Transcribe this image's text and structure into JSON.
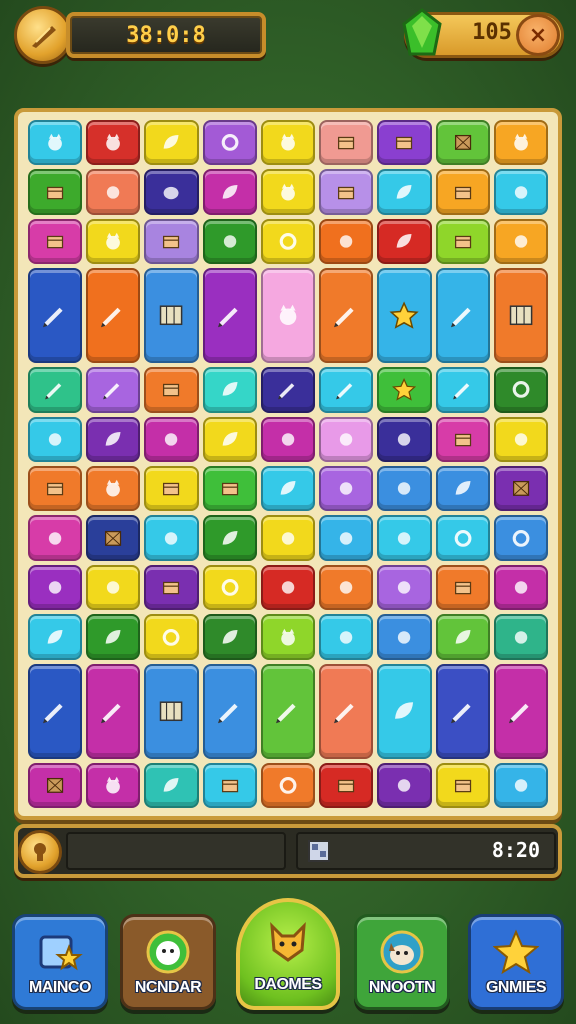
{
  "top": {
    "timer": "38:0:8",
    "score": "105",
    "close_label": "×"
  },
  "board": {
    "tiles": [
      {
        "c": 0,
        "r": 0,
        "w": 1,
        "h": 1,
        "color": "#35c9e8",
        "icon": "cat-face-icon"
      },
      {
        "c": 1,
        "r": 0,
        "w": 1,
        "h": 1,
        "color": "#d6302a",
        "icon": "frog-icon"
      },
      {
        "c": 2,
        "r": 0,
        "w": 1,
        "h": 1,
        "color": "#f2d91c",
        "icon": "leaf-icon"
      },
      {
        "c": 3,
        "r": 0,
        "w": 1,
        "h": 1,
        "color": "#a35ad6",
        "icon": "swirl-icon"
      },
      {
        "c": 4,
        "r": 0,
        "w": 1,
        "h": 1,
        "color": "#f2d91c",
        "icon": "bird-icon"
      },
      {
        "c": 5,
        "r": 0,
        "w": 1,
        "h": 1,
        "color": "#f09a92",
        "icon": "box-icon"
      },
      {
        "c": 6,
        "r": 0,
        "w": 1,
        "h": 1,
        "color": "#8a3fd0",
        "icon": "book-icon"
      },
      {
        "c": 7,
        "r": 0,
        "w": 1,
        "h": 1,
        "color": "#62c43a",
        "icon": "crate-icon"
      },
      {
        "c": 8,
        "r": 0,
        "w": 1,
        "h": 1,
        "color": "#f7a623",
        "icon": "cat-icon"
      },
      {
        "c": 0,
        "r": 1,
        "w": 1,
        "h": 1,
        "color": "#3daa2c",
        "icon": "block-icon"
      },
      {
        "c": 1,
        "r": 1,
        "w": 1,
        "h": 1,
        "color": "#f07a55",
        "icon": "roll-icon"
      },
      {
        "c": 2,
        "r": 1,
        "w": 1,
        "h": 1,
        "color": "#3a2f9a",
        "icon": "blob-icon"
      },
      {
        "c": 3,
        "r": 1,
        "w": 1,
        "h": 1,
        "color": "#c42fa8",
        "icon": "bush-icon"
      },
      {
        "c": 4,
        "r": 1,
        "w": 1,
        "h": 1,
        "color": "#f2d91c",
        "icon": "cat-icon"
      },
      {
        "c": 5,
        "r": 1,
        "w": 1,
        "h": 1,
        "color": "#b790e8",
        "icon": "chest-icon"
      },
      {
        "c": 6,
        "r": 1,
        "w": 1,
        "h": 1,
        "color": "#35c9e8",
        "icon": "hat-icon"
      },
      {
        "c": 7,
        "r": 1,
        "w": 1,
        "h": 1,
        "color": "#f7a623",
        "icon": "box-icon"
      },
      {
        "c": 8,
        "r": 1,
        "w": 1,
        "h": 1,
        "color": "#35c9e8",
        "icon": "apple-icon"
      },
      {
        "c": 0,
        "r": 2,
        "w": 1,
        "h": 1,
        "color": "#d73ca8",
        "icon": "box-icon"
      },
      {
        "c": 1,
        "r": 2,
        "w": 1,
        "h": 1,
        "color": "#f2d91c",
        "icon": "bunny-icon"
      },
      {
        "c": 2,
        "r": 2,
        "w": 1,
        "h": 1,
        "color": "#a884e0",
        "icon": "cube-icon"
      },
      {
        "c": 3,
        "r": 2,
        "w": 1,
        "h": 1,
        "color": "#2f9a2a",
        "icon": "paw-icon"
      },
      {
        "c": 4,
        "r": 2,
        "w": 1,
        "h": 1,
        "color": "#f2d91c",
        "icon": "spiral-icon"
      },
      {
        "c": 5,
        "r": 2,
        "w": 1,
        "h": 1,
        "color": "#f0701e",
        "icon": "roll-icon"
      },
      {
        "c": 6,
        "r": 2,
        "w": 1,
        "h": 1,
        "color": "#d62a24",
        "icon": "hat-icon"
      },
      {
        "c": 7,
        "r": 2,
        "w": 1,
        "h": 1,
        "color": "#8fd62a",
        "icon": "cube-icon"
      },
      {
        "c": 8,
        "r": 2,
        "w": 1,
        "h": 1,
        "color": "#f7a623",
        "icon": "cross-icon"
      },
      {
        "c": 0,
        "r": 3,
        "w": 1,
        "h": 2,
        "color": "#2a58c4",
        "icon": "pencil-icon"
      },
      {
        "c": 1,
        "r": 3,
        "w": 1,
        "h": 2,
        "color": "#f0701e",
        "icon": "pencil-icon"
      },
      {
        "c": 2,
        "r": 3,
        "w": 1,
        "h": 2,
        "color": "#3b8fe0",
        "icon": "map-icon"
      },
      {
        "c": 3,
        "r": 3,
        "w": 1,
        "h": 2,
        "color": "#9a2fc0",
        "icon": "pencil-icon"
      },
      {
        "c": 4,
        "r": 3,
        "w": 1,
        "h": 2,
        "color": "#f5a8e0",
        "icon": "robot-icon"
      },
      {
        "c": 5,
        "r": 3,
        "w": 1,
        "h": 2,
        "color": "#f07a2a",
        "icon": "pencil-icon"
      },
      {
        "c": 6,
        "r": 3,
        "w": 1,
        "h": 2,
        "color": "#35b4e8",
        "icon": "star-icon"
      },
      {
        "c": 7,
        "r": 3,
        "w": 1,
        "h": 2,
        "color": "#35b4e8",
        "icon": "pencil-icon"
      },
      {
        "c": 8,
        "r": 3,
        "w": 1,
        "h": 2,
        "color": "#f07a2a",
        "icon": "map-icon"
      },
      {
        "c": 0,
        "r": 5,
        "w": 1,
        "h": 1,
        "color": "#2fc28a",
        "icon": "pencil-icon"
      },
      {
        "c": 1,
        "r": 5,
        "w": 1,
        "h": 1,
        "color": "#a865e0",
        "icon": "pencil-icon"
      },
      {
        "c": 2,
        "r": 5,
        "w": 1,
        "h": 1,
        "color": "#f07a2a",
        "icon": "calendar-icon"
      },
      {
        "c": 3,
        "r": 5,
        "w": 1,
        "h": 1,
        "color": "#35d6c8",
        "icon": "leaf-icon"
      },
      {
        "c": 4,
        "r": 5,
        "w": 1,
        "h": 1,
        "color": "#3a2f9a",
        "icon": "pencil-icon"
      },
      {
        "c": 5,
        "r": 5,
        "w": 1,
        "h": 1,
        "color": "#35c9e8",
        "icon": "pencil-icon"
      },
      {
        "c": 6,
        "r": 5,
        "w": 1,
        "h": 1,
        "color": "#3fbf3a",
        "icon": "star-icon"
      },
      {
        "c": 7,
        "r": 5,
        "w": 1,
        "h": 1,
        "color": "#35c9e8",
        "icon": "pencil-icon"
      },
      {
        "c": 8,
        "r": 5,
        "w": 1,
        "h": 1,
        "color": "#2f8a2a",
        "icon": "cookie-icon"
      },
      {
        "c": 0,
        "r": 6,
        "w": 1,
        "h": 1,
        "color": "#35c9e8",
        "icon": "key-icon"
      },
      {
        "c": 1,
        "r": 6,
        "w": 1,
        "h": 1,
        "color": "#7a2fb0",
        "icon": "plant-icon"
      },
      {
        "c": 2,
        "r": 6,
        "w": 1,
        "h": 1,
        "color": "#c42fa8",
        "icon": "pot-icon"
      },
      {
        "c": 3,
        "r": 6,
        "w": 1,
        "h": 1,
        "color": "#f2d91c",
        "icon": "bush-icon"
      },
      {
        "c": 4,
        "r": 6,
        "w": 1,
        "h": 1,
        "color": "#c42fa8",
        "icon": "splat-icon"
      },
      {
        "c": 5,
        "r": 6,
        "w": 1,
        "h": 1,
        "color": "#e89ae8",
        "icon": "pretzel-icon"
      },
      {
        "c": 6,
        "r": 6,
        "w": 1,
        "h": 1,
        "color": "#3a2f9a",
        "icon": "roll-icon"
      },
      {
        "c": 7,
        "r": 6,
        "w": 1,
        "h": 1,
        "color": "#d73ca8",
        "icon": "box-icon"
      },
      {
        "c": 8,
        "r": 6,
        "w": 1,
        "h": 1,
        "color": "#f2d91c",
        "icon": "rose-icon"
      },
      {
        "c": 0,
        "r": 7,
        "w": 1,
        "h": 1,
        "color": "#f07a2a",
        "icon": "house-icon"
      },
      {
        "c": 1,
        "r": 7,
        "w": 1,
        "h": 1,
        "color": "#f07a2a",
        "icon": "face-icon"
      },
      {
        "c": 2,
        "r": 7,
        "w": 1,
        "h": 1,
        "color": "#f2d91c",
        "icon": "block-icon"
      },
      {
        "c": 3,
        "r": 7,
        "w": 1,
        "h": 1,
        "color": "#3fbf3a",
        "icon": "block-icon"
      },
      {
        "c": 4,
        "r": 7,
        "w": 1,
        "h": 1,
        "color": "#35c9e8",
        "icon": "lizard-icon"
      },
      {
        "c": 5,
        "r": 7,
        "w": 1,
        "h": 1,
        "color": "#a865e0",
        "icon": "keyhole-icon"
      },
      {
        "c": 6,
        "r": 7,
        "w": 1,
        "h": 1,
        "color": "#3b8fe0",
        "icon": "paw-icon"
      },
      {
        "c": 7,
        "r": 7,
        "w": 1,
        "h": 1,
        "color": "#3b8fe0",
        "icon": "tree-icon"
      },
      {
        "c": 8,
        "r": 7,
        "w": 1,
        "h": 1,
        "color": "#7a2fb0",
        "icon": "crate-icon"
      },
      {
        "c": 0,
        "r": 8,
        "w": 1,
        "h": 1,
        "color": "#d73ca8",
        "icon": "cheese-icon"
      },
      {
        "c": 1,
        "r": 8,
        "w": 1,
        "h": 1,
        "color": "#2a3f9a",
        "icon": "crate-icon"
      },
      {
        "c": 2,
        "r": 8,
        "w": 1,
        "h": 1,
        "color": "#35c9e8",
        "icon": "tomato-icon"
      },
      {
        "c": 3,
        "r": 8,
        "w": 1,
        "h": 1,
        "color": "#2f9a2a",
        "icon": "bush-icon"
      },
      {
        "c": 4,
        "r": 8,
        "w": 1,
        "h": 1,
        "color": "#f2d91c",
        "icon": "boot-icon"
      },
      {
        "c": 5,
        "r": 8,
        "w": 1,
        "h": 1,
        "color": "#35b4e8",
        "icon": "drop-icon"
      },
      {
        "c": 6,
        "r": 8,
        "w": 1,
        "h": 1,
        "color": "#35c9e8",
        "icon": "roll-icon"
      },
      {
        "c": 7,
        "r": 8,
        "w": 1,
        "h": 1,
        "color": "#35c9e8",
        "icon": "gear-icon"
      },
      {
        "c": 8,
        "r": 8,
        "w": 1,
        "h": 1,
        "color": "#3b8fe0",
        "icon": "ring-icon"
      },
      {
        "c": 0,
        "r": 9,
        "w": 1,
        "h": 1,
        "color": "#9a2fc0",
        "icon": "dots-icon"
      },
      {
        "c": 1,
        "r": 9,
        "w": 1,
        "h": 1,
        "color": "#f2d91c",
        "icon": "splat-icon"
      },
      {
        "c": 2,
        "r": 9,
        "w": 1,
        "h": 1,
        "color": "#7a2fb0",
        "icon": "chest-icon"
      },
      {
        "c": 3,
        "r": 9,
        "w": 1,
        "h": 1,
        "color": "#f2d91c",
        "icon": "ring-icon"
      },
      {
        "c": 4,
        "r": 9,
        "w": 1,
        "h": 1,
        "color": "#d62a24",
        "icon": "bean-icon"
      },
      {
        "c": 5,
        "r": 9,
        "w": 1,
        "h": 1,
        "color": "#f07a2a",
        "icon": "egg-icon"
      },
      {
        "c": 6,
        "r": 9,
        "w": 1,
        "h": 1,
        "color": "#a865e0",
        "icon": "mushroom-icon"
      },
      {
        "c": 7,
        "r": 9,
        "w": 1,
        "h": 1,
        "color": "#f07a2a",
        "icon": "jar-icon"
      },
      {
        "c": 8,
        "r": 9,
        "w": 1,
        "h": 1,
        "color": "#c42fa8",
        "icon": "basket-icon"
      },
      {
        "c": 0,
        "r": 10,
        "w": 1,
        "h": 1,
        "color": "#35c9e8",
        "icon": "lizard-icon"
      },
      {
        "c": 1,
        "r": 10,
        "w": 1,
        "h": 1,
        "color": "#2f9a2a",
        "icon": "bush-icon"
      },
      {
        "c": 2,
        "r": 10,
        "w": 1,
        "h": 1,
        "color": "#f2d91c",
        "icon": "ring-icon"
      },
      {
        "c": 3,
        "r": 10,
        "w": 1,
        "h": 1,
        "color": "#2f8a2a",
        "icon": "leaf-icon"
      },
      {
        "c": 4,
        "r": 10,
        "w": 1,
        "h": 1,
        "color": "#8fd62a",
        "icon": "cat-icon"
      },
      {
        "c": 5,
        "r": 10,
        "w": 1,
        "h": 1,
        "color": "#35c9e8",
        "icon": "roll-icon"
      },
      {
        "c": 6,
        "r": 10,
        "w": 1,
        "h": 1,
        "color": "#3b8fe0",
        "icon": "splash-icon"
      },
      {
        "c": 7,
        "r": 10,
        "w": 1,
        "h": 1,
        "color": "#62c43a",
        "icon": "maple-icon"
      },
      {
        "c": 8,
        "r": 10,
        "w": 1,
        "h": 1,
        "color": "#2fb48a",
        "icon": "mushroom-icon"
      },
      {
        "c": 0,
        "r": 11,
        "w": 1,
        "h": 2,
        "color": "#2a58c4",
        "icon": "pencil-icon"
      },
      {
        "c": 1,
        "r": 11,
        "w": 1,
        "h": 2,
        "color": "#c42fa8",
        "icon": "pencil-icon"
      },
      {
        "c": 2,
        "r": 11,
        "w": 1,
        "h": 2,
        "color": "#3b8fe0",
        "icon": "map-icon"
      },
      {
        "c": 3,
        "r": 11,
        "w": 1,
        "h": 2,
        "color": "#3b8fe0",
        "icon": "pencil-icon"
      },
      {
        "c": 4,
        "r": 11,
        "w": 1,
        "h": 2,
        "color": "#62c43a",
        "icon": "pencil-icon"
      },
      {
        "c": 5,
        "r": 11,
        "w": 1,
        "h": 2,
        "color": "#f07a55",
        "icon": "pencil-icon"
      },
      {
        "c": 6,
        "r": 11,
        "w": 1,
        "h": 2,
        "color": "#35c9e8",
        "icon": "fish-icon"
      },
      {
        "c": 7,
        "r": 11,
        "w": 1,
        "h": 2,
        "color": "#3b4fc4",
        "icon": "pencil-icon"
      },
      {
        "c": 8,
        "r": 11,
        "w": 1,
        "h": 2,
        "color": "#c42fa8",
        "icon": "pencil-icon"
      },
      {
        "c": 0,
        "r": 13,
        "w": 1,
        "h": 1,
        "color": "#c42fa8",
        "icon": "crate-icon"
      },
      {
        "c": 1,
        "r": 13,
        "w": 1,
        "h": 1,
        "color": "#c42fa8",
        "icon": "face-icon"
      },
      {
        "c": 2,
        "r": 13,
        "w": 1,
        "h": 1,
        "color": "#2fc2b4",
        "icon": "kite-icon"
      },
      {
        "c": 3,
        "r": 13,
        "w": 1,
        "h": 1,
        "color": "#35c9e8",
        "icon": "door-icon"
      },
      {
        "c": 4,
        "r": 13,
        "w": 1,
        "h": 1,
        "color": "#f07a2a",
        "icon": "target-icon"
      },
      {
        "c": 5,
        "r": 13,
        "w": 1,
        "h": 1,
        "color": "#d62a24",
        "icon": "door-icon"
      },
      {
        "c": 6,
        "r": 13,
        "w": 1,
        "h": 1,
        "color": "#7a2fb0",
        "icon": "cheese-icon"
      },
      {
        "c": 7,
        "r": 13,
        "w": 1,
        "h": 1,
        "color": "#f2d91c",
        "icon": "chest-icon"
      },
      {
        "c": 8,
        "r": 13,
        "w": 1,
        "h": 1,
        "color": "#35b4e8",
        "icon": "paw-icon"
      }
    ]
  },
  "bottom_bar": {
    "progress": 0.0,
    "time": "8:20"
  },
  "nav": {
    "items": [
      {
        "label": "MAINCO",
        "color": "#2f7ad6"
      },
      {
        "label": "NCNDAR",
        "color": "#8a5a2a"
      },
      {
        "label": "DAOMES",
        "color": "#6fc120"
      },
      {
        "label": "NNOOTN",
        "color": "#3fa53a"
      },
      {
        "label": "GNMIES",
        "color": "#2f6fd6"
      }
    ]
  }
}
